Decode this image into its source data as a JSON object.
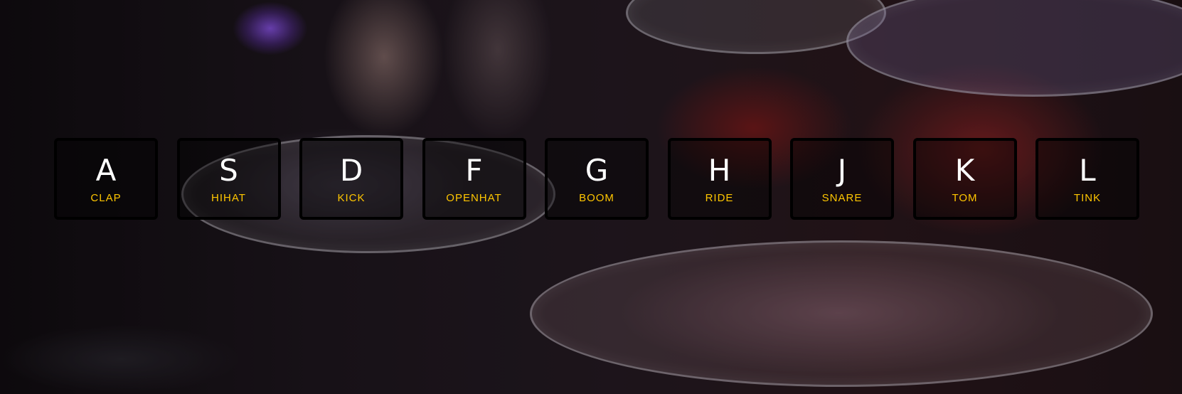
{
  "theme": {
    "accent_color": "#ffc600",
    "key_text_color": "#ffffff",
    "key_border_color": "#000000"
  },
  "background": {
    "description_icon": "drum-kit-photo"
  },
  "keys": [
    {
      "letter": "A",
      "sound": "CLAP"
    },
    {
      "letter": "S",
      "sound": "HIHAT"
    },
    {
      "letter": "D",
      "sound": "KICK"
    },
    {
      "letter": "F",
      "sound": "OPENHAT"
    },
    {
      "letter": "G",
      "sound": "BOOM"
    },
    {
      "letter": "H",
      "sound": "RIDE"
    },
    {
      "letter": "J",
      "sound": "SNARE"
    },
    {
      "letter": "K",
      "sound": "TOM"
    },
    {
      "letter": "L",
      "sound": "TINK"
    }
  ]
}
